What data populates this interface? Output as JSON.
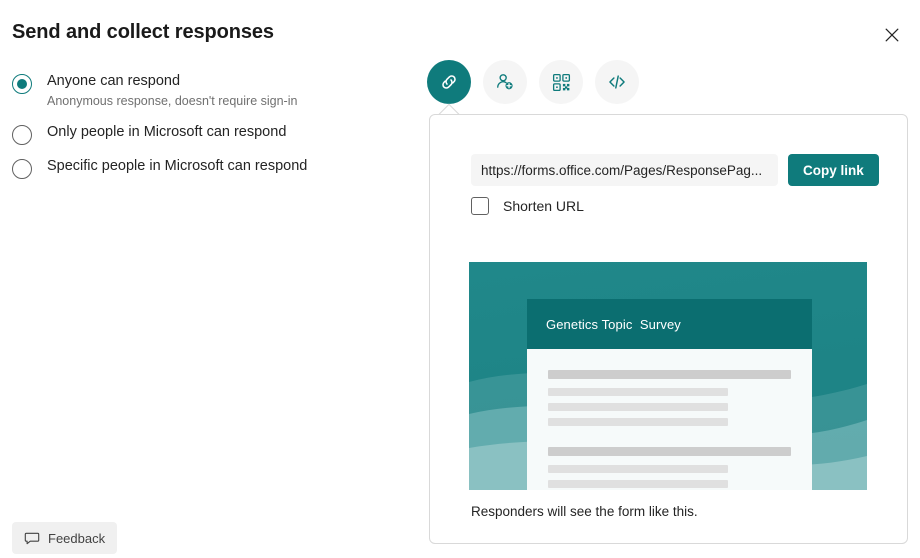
{
  "theme": {
    "accent": "#0f7b7c",
    "accent_dark": "#0b6e70",
    "preview_bg": "#1c8184"
  },
  "header": {
    "title": "Send and collect responses",
    "close_icon": "close-icon"
  },
  "options": {
    "items": [
      {
        "label": "Anyone can respond",
        "description": "Anonymous response, doesn't require sign-in",
        "checked": true
      },
      {
        "label": "Only people in Microsoft can respond",
        "description": "",
        "checked": false
      },
      {
        "label": "Specific people in Microsoft can respond",
        "description": "",
        "checked": false
      }
    ]
  },
  "feedback": {
    "label": "Feedback",
    "icon": "comment-icon"
  },
  "tabs": [
    {
      "name": "link",
      "icon": "link-icon",
      "selected": true
    },
    {
      "name": "invite-people",
      "icon": "person-add-icon",
      "selected": false
    },
    {
      "name": "qr-code",
      "icon": "qr-code-icon",
      "selected": false
    },
    {
      "name": "embed",
      "icon": "embed-code-icon",
      "selected": false
    }
  ],
  "share_panel": {
    "link_value": "https://forms.office.com/Pages/ResponsePag...",
    "link_placeholder": "https://forms.office.com/Pages/ResponsePag...",
    "copy_label": "Copy link",
    "shorten_url_label": "Shorten URL",
    "shorten_url_checked": false,
    "preview": {
      "form_title": "Genetics Topic  Survey",
      "caption": "Responders will see the form like this."
    }
  }
}
